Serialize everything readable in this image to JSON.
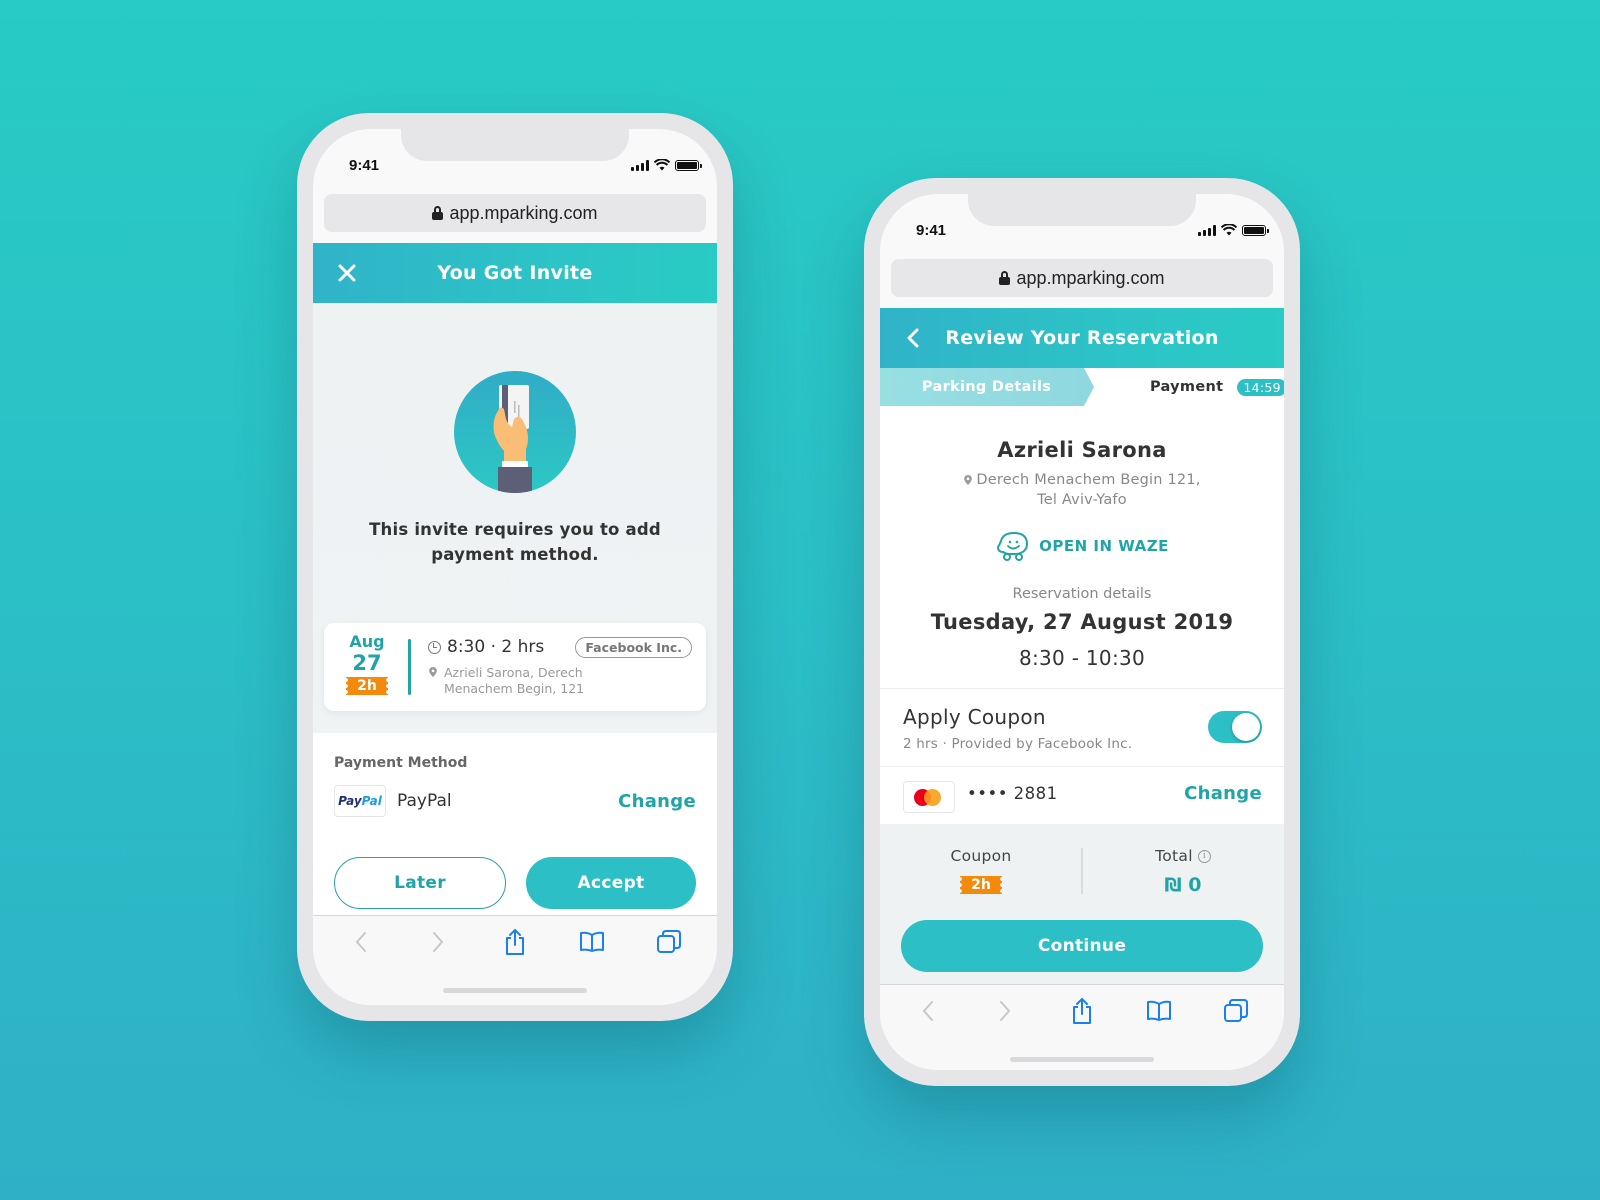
{
  "theme": {
    "accent": "#2cbfc5",
    "accent_text": "#21a4a8",
    "coupon_orange": "#f38a0c",
    "background_top": "#28cbc5",
    "background_bottom": "#2fb0c6"
  },
  "left_phone": {
    "status_bar": {
      "time": "9:41"
    },
    "browser": {
      "url": "app.mparking.com"
    },
    "header": {
      "title": "You Got Invite",
      "close_icon": "close-icon"
    },
    "illustration": "hand-holding-card-icon",
    "message": "This invite requires you to add payment method.",
    "reservation_card": {
      "month": "Aug",
      "day": "27",
      "duration_badge": "2h",
      "time": "8:30 · 2 hrs",
      "company": "Facebook Inc.",
      "address_line1": "Azrieli Sarona, Derech",
      "address_line2": "Menachem Begin, 121"
    },
    "payment": {
      "label": "Payment Method",
      "logo_text_a": "Pay",
      "logo_text_b": "Pal",
      "method": "PayPal",
      "change_label": "Change"
    },
    "buttons": {
      "later": "Later",
      "accept": "Accept"
    },
    "toolbar": [
      "back-icon",
      "forward-icon",
      "share-icon",
      "bookmarks-icon",
      "tabs-icon"
    ]
  },
  "right_phone": {
    "status_bar": {
      "time": "9:41"
    },
    "browser": {
      "url": "app.mparking.com"
    },
    "header": {
      "title": "Review Your Reservation",
      "back_icon": "chevron-left-icon"
    },
    "steps": {
      "previous": "Parking Details",
      "current": "Payment",
      "timer": "14:59"
    },
    "place": {
      "name": "Azrieli Sarona",
      "address_line1": "Derech Menachem Begin 121,",
      "address_line2": "Tel Aviv-Yafo",
      "waze_label": "OPEN IN WAZE"
    },
    "reservation": {
      "label": "Reservation details",
      "date": "Tuesday, 27 August 2019",
      "time_range": "8:30 - 10:30"
    },
    "coupon": {
      "title": "Apply Coupon",
      "subtitle": "2 hrs · Provided by Facebook Inc.",
      "enabled": true
    },
    "card": {
      "masked_number": "•••• 2881",
      "change_label": "Change"
    },
    "summary": {
      "coupon_label": "Coupon",
      "coupon_badge": "2h",
      "total_label": "Total",
      "total_value": "₪ 0"
    },
    "continue_label": "Continue",
    "toolbar": [
      "back-icon",
      "forward-icon",
      "share-icon",
      "bookmarks-icon",
      "tabs-icon"
    ]
  }
}
